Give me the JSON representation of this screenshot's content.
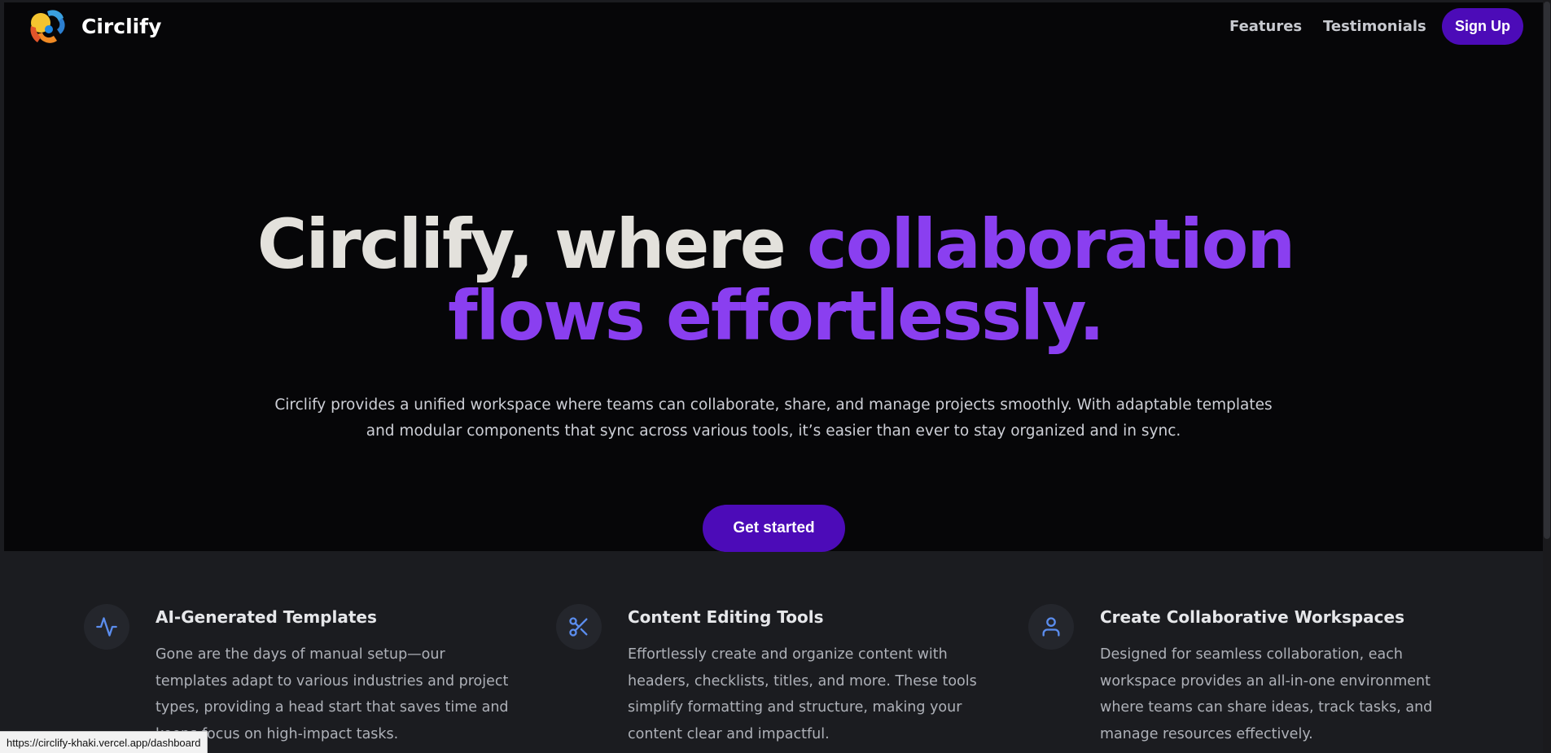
{
  "header": {
    "brand": "Circlify",
    "nav": {
      "features": "Features",
      "testimonials": "Testimonials",
      "signup": "Sign Up"
    }
  },
  "hero": {
    "headline_plain": "Circlify, where ",
    "headline_accent_1": "collaboration",
    "headline_accent_2": "flows effortlessly.",
    "subtext": "Circlify provides a unified workspace where teams can collaborate, share, and manage projects smoothly. With adaptable templates and modular components that sync across various tools, it’s easier than ever to stay organized and in sync.",
    "cta": "Get started"
  },
  "features": [
    {
      "icon": "activity-icon",
      "title": "AI-Generated Templates",
      "desc": "Gone are the days of manual setup—our templates adapt to various industries and project types, providing a head start that saves time and keeps focus on high-impact tasks."
    },
    {
      "icon": "scissors-icon",
      "title": "Content Editing Tools",
      "desc": "Effortlessly create and organize content with headers, checklists, titles, and more. These tools simplify formatting and structure, making your content clear and impactful."
    },
    {
      "icon": "user-icon",
      "title": "Create Collaborative Workspaces",
      "desc": "Designed for seamless collaboration, each workspace provides an all-in-one environment where teams can share ideas, track tasks, and manage resources effectively."
    }
  ],
  "status_bar": {
    "url": "https://circlify-khaki.vercel.app/dashboard"
  },
  "colors": {
    "accent": "#8a3ff0",
    "button": "#4c0bb8",
    "hero_bg": "#060608",
    "section_bg": "#1b1c20",
    "icon_blue": "#5b8dee"
  }
}
